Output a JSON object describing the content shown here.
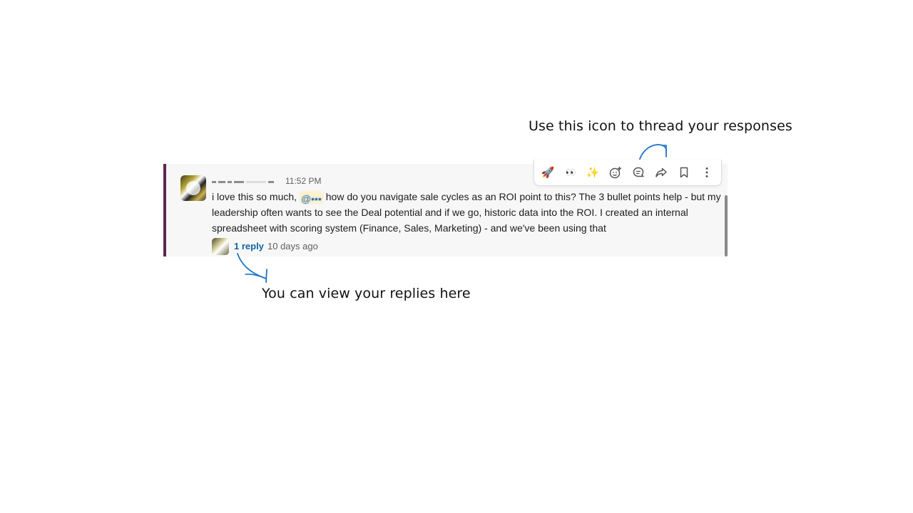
{
  "annotations": {
    "top": "Use this icon to thread your responses",
    "bottom": "You can view your replies here"
  },
  "message": {
    "timestamp": "11:52 PM",
    "text_before_mention": "i love this so much, ",
    "mention": "@•••",
    "text_after_mention": " how do you navigate sale cycles as an ROI point to this? The 3 bullet points help - but my leadership often wants to see the Deal potential and if we go, historic data into the ROI. I created an internal spreadsheet with scoring system (Finance, Sales, Marketing) - and we've been using that"
  },
  "thread": {
    "reply_label": "1 reply",
    "reply_time": "10 days ago"
  },
  "toolbar": {
    "icons": [
      "rocket-icon",
      "eyes-icon",
      "sparkles-icon",
      "add-reaction-icon",
      "reply-in-thread-icon",
      "share-icon",
      "bookmark-icon",
      "more-actions-icon"
    ],
    "glyphs": {
      "rocket": "🚀",
      "eyes": "👀",
      "sparkles": "✨"
    }
  },
  "colors": {
    "accent_bar": "#5e2750",
    "link": "#1264a3",
    "annotation_arrow": "#1a73c8"
  }
}
